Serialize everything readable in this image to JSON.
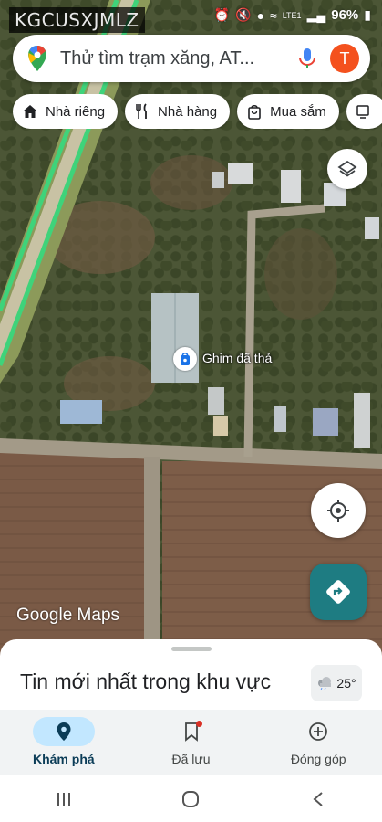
{
  "status_bar": {
    "overlay_text": "KGCUSXJMLZ",
    "battery": "96%",
    "network": "LTE1"
  },
  "search": {
    "placeholder": "Thử tìm trạm xăng, AT...",
    "avatar_letter": "T"
  },
  "chips": [
    {
      "icon": "home-icon",
      "label": "Nhà riêng"
    },
    {
      "icon": "restaurant-icon",
      "label": "Nhà hàng"
    },
    {
      "icon": "shopping-bag-icon",
      "label": "Mua sắm"
    },
    {
      "icon": "more-icon",
      "label": ""
    }
  ],
  "map": {
    "pin_label": "Ghim đã thả",
    "attribution": "Google Maps"
  },
  "sheet": {
    "title": "Tin mới nhất trong khu vực",
    "weather_temp": "25°"
  },
  "bottom_nav": [
    {
      "icon": "location-pin-icon",
      "label": "Khám phá",
      "active": true
    },
    {
      "icon": "bookmark-icon",
      "label": "Đã lưu",
      "active": false
    },
    {
      "icon": "add-circle-icon",
      "label": "Đóng góp",
      "active": false
    }
  ],
  "colors": {
    "accent": "#1e7c82",
    "avatar": "#f4511e",
    "active_nav": "#c2e7ff"
  }
}
